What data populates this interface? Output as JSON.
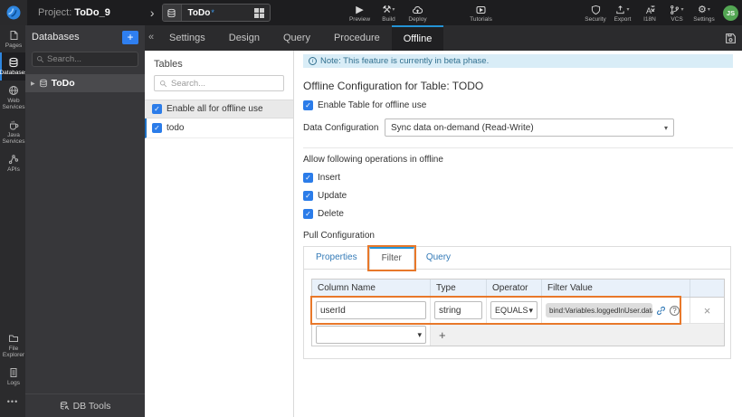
{
  "icons": {
    "check": "✓",
    "caret_down": "▾",
    "collapse": "«",
    "chevron_right": "›",
    "expand_caret": "▶",
    "close": "×",
    "add": "+",
    "more": "•••",
    "play": "▶",
    "gear": "⚙",
    "build": "⚒",
    "help": "?",
    "note_i": "i"
  },
  "topbar": {
    "project_label": "Project:",
    "project_name": "ToDo_9",
    "doc_tab": {
      "label": "ToDo",
      "modified": "*"
    },
    "actions_center": {
      "preview": "Preview",
      "build": "Build",
      "deploy": "Deploy",
      "tutorials": "Tutorials"
    },
    "actions_right": {
      "security": "Security",
      "export": "Export",
      "i18n": "I18N",
      "vcs": "VCS",
      "settings": "Settings"
    },
    "avatar": "JS"
  },
  "rail": {
    "items": [
      {
        "label": "Pages"
      },
      {
        "label": "Databases"
      },
      {
        "label": "Web Services"
      },
      {
        "label": "Java Services"
      },
      {
        "label": "APIs"
      },
      {
        "label": "File Explorer"
      },
      {
        "label": "Logs"
      }
    ]
  },
  "db_panel": {
    "title": "Databases",
    "search_placeholder": "Search...",
    "items": [
      {
        "label": "ToDo"
      }
    ],
    "db_tools_label": "DB Tools"
  },
  "tabbar": {
    "tabs": [
      {
        "label": "Settings"
      },
      {
        "label": "Design"
      },
      {
        "label": "Query"
      },
      {
        "label": "Procedure"
      },
      {
        "label": "Offline"
      }
    ],
    "active": "Offline"
  },
  "tables_panel": {
    "title": "Tables",
    "search_placeholder": "Search...",
    "enable_all_label": "Enable all for offline use",
    "items": [
      {
        "label": "todo",
        "checked": true
      }
    ]
  },
  "main": {
    "note_text": "Note: This feature is currently in beta phase.",
    "title": "Offline Configuration for Table: TODO",
    "enable_table_label": "Enable Table for offline use",
    "data_configuration_label": "Data Configuration",
    "data_configuration_value": "Sync data on-demand (Read-Write)",
    "operations_label": "Allow following operations in offline",
    "operations": [
      "Insert",
      "Update",
      "Delete"
    ],
    "pull_configuration_label": "Pull Configuration",
    "pull_tabs": [
      "Properties",
      "Filter",
      "Query"
    ],
    "pull_active_tab": "Filter",
    "filter_table": {
      "headers": [
        "Column Name",
        "Type",
        "Operator",
        "Filter Value"
      ],
      "row": {
        "column_name": "userId",
        "type": "string",
        "operator": "EQUALS",
        "filter_value": "bind:Variables.loggedInUser.data"
      }
    }
  },
  "colors": {
    "accent_blue": "#2e86e0",
    "tab_active_blue": "#2493d6",
    "annotation_orange": "#e8782a",
    "note_bg": "#d9edf7",
    "note_text": "#31708f",
    "link_blue": "#337ab7",
    "selected_row_border": "#1d6fc2"
  }
}
